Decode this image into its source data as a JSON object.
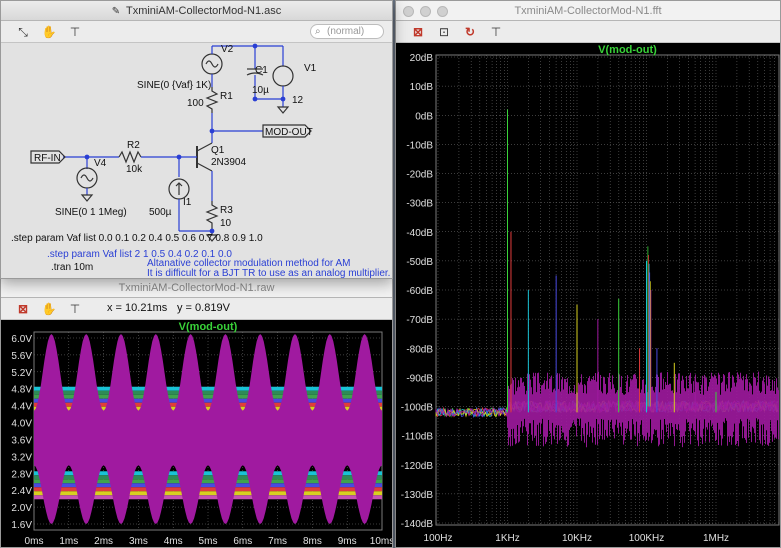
{
  "schematic_window": {
    "title": "TxminiAM-CollectorMod-N1.asc",
    "search_placeholder": "(normal)",
    "labels": {
      "v2": "V2",
      "v2_value": "SINE(0 {Vaf} 1K)",
      "r1": "R1",
      "r1_value": "100",
      "c1": "C1",
      "c1_value": "10µ",
      "v1": "V1",
      "v1_value": "12",
      "mod_out": "MOD-OUT",
      "rf_in": "RF-IN",
      "v4": "V4",
      "r2": "R2",
      "r2_value": "10k",
      "q1": "Q1",
      "q1_value": "2N3904",
      "i1": "I1",
      "i1_value": "500µ",
      "r3": "R3",
      "r3_value": "10",
      "v4_value": "SINE(0 1 1Meg)",
      "step1": ".step param Vaf list  0.0 0.1 0.2 0.4 0.5 0.6 0.7 0.8 0.9 1.0",
      "step2": ".step param Vaf list  2 1 0.5 0.4 0.2 0.1 0.0",
      "tran": ".tran 10m",
      "comment1": "Altanative collector modulation method for AM",
      "comment2": "It is difficult for a BJT TR to use as an analog multiplier."
    }
  },
  "raw_window": {
    "title": "TxminiAM-CollectorMod-N1.raw",
    "readout_x": "x = 10.21ms",
    "readout_y": "y = 0.819V",
    "trace_name": "V(mod-out)",
    "y_ticks": [
      "6.0V",
      "5.6V",
      "5.2V",
      "4.8V",
      "4.4V",
      "4.0V",
      "3.6V",
      "3.2V",
      "2.8V",
      "2.4V",
      "2.0V",
      "1.6V"
    ],
    "x_ticks": [
      "0ms",
      "1ms",
      "2ms",
      "3ms",
      "4ms",
      "5ms",
      "6ms",
      "7ms",
      "8ms",
      "9ms",
      "10ms"
    ]
  },
  "fft_window": {
    "title": "TxminiAM-CollectorMod-N1.fft",
    "trace_name": "V(mod-out)",
    "y_ticks": [
      "20dB",
      "10dB",
      "0dB",
      "-10dB",
      "-20dB",
      "-30dB",
      "-40dB",
      "-50dB",
      "-60dB",
      "-70dB",
      "-80dB",
      "-90dB",
      "-100dB",
      "-110dB",
      "-120dB",
      "-130dB",
      "-140dB"
    ],
    "x_ticks": [
      "100Hz",
      "1KHz",
      "10KHz",
      "100KHz",
      "1MHz"
    ]
  },
  "colors": {
    "trace_primary": "#a01aa0",
    "trace_label": "#39d339",
    "axis_text": "#e0e0e0",
    "grid": "#7a7a7a",
    "wire": "#2a3fd4",
    "comment": "#2a3fd4"
  }
}
